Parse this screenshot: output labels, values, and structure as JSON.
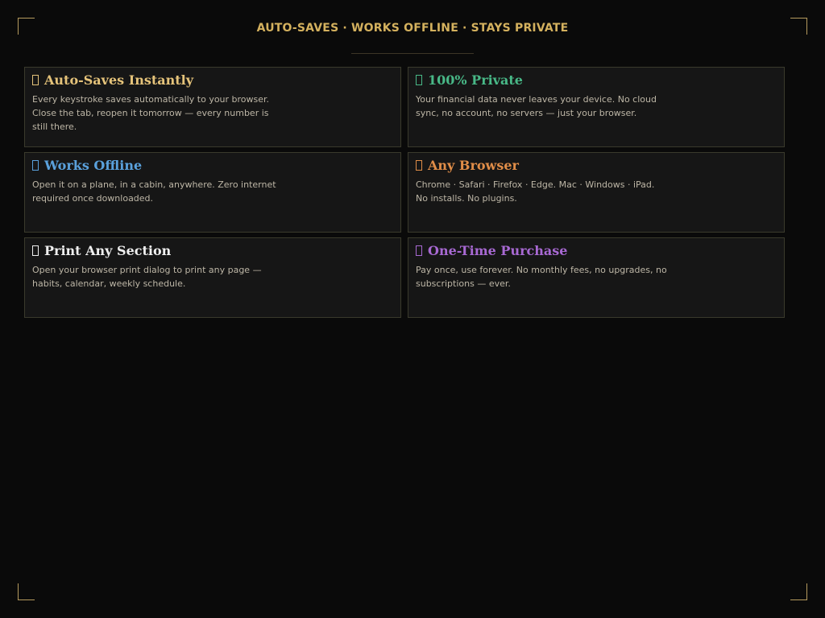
{
  "header": {
    "title": "AUTO-SAVES · WORKS OFFLINE · STAYS PRIVATE"
  },
  "features": [
    {
      "icon": "save-icon",
      "title": "Auto-Saves Instantly",
      "description": "Every keystroke saves automatically to your browser. Close the tab, reopen it tomorrow — every number is still there.",
      "color": "#e5c37a"
    },
    {
      "icon": "lock-icon",
      "title": "100% Private",
      "description": "Your financial data never leaves your device. No cloud sync, no account, no servers — just your browser.",
      "color": "#48b887"
    },
    {
      "icon": "plane-icon",
      "title": "Works Offline",
      "description": "Open it on a plane, in a cabin, anywhere. Zero internet required once downloaded.",
      "color": "#5aa1dc"
    },
    {
      "icon": "globe-icon",
      "title": "Any Browser",
      "description": "Chrome · Safari · Firefox · Edge. Mac · Windows · iPad. No installs. No plugins.",
      "color": "#e08d48"
    },
    {
      "icon": "printer-icon",
      "title": "Print Any Section",
      "description": "Open your browser print dialog to print any page — habits, calendar, weekly schedule.",
      "color": "#efefef"
    },
    {
      "icon": "tag-icon",
      "title": "One-Time Purchase",
      "description": "Pay once, use forever. No monthly fees, no upgrades, no subscriptions — ever.",
      "color": "#a869d3"
    }
  ],
  "colors": {
    "background": "#0a0a0a",
    "card": "#161616",
    "accent": "#d4b15e"
  }
}
